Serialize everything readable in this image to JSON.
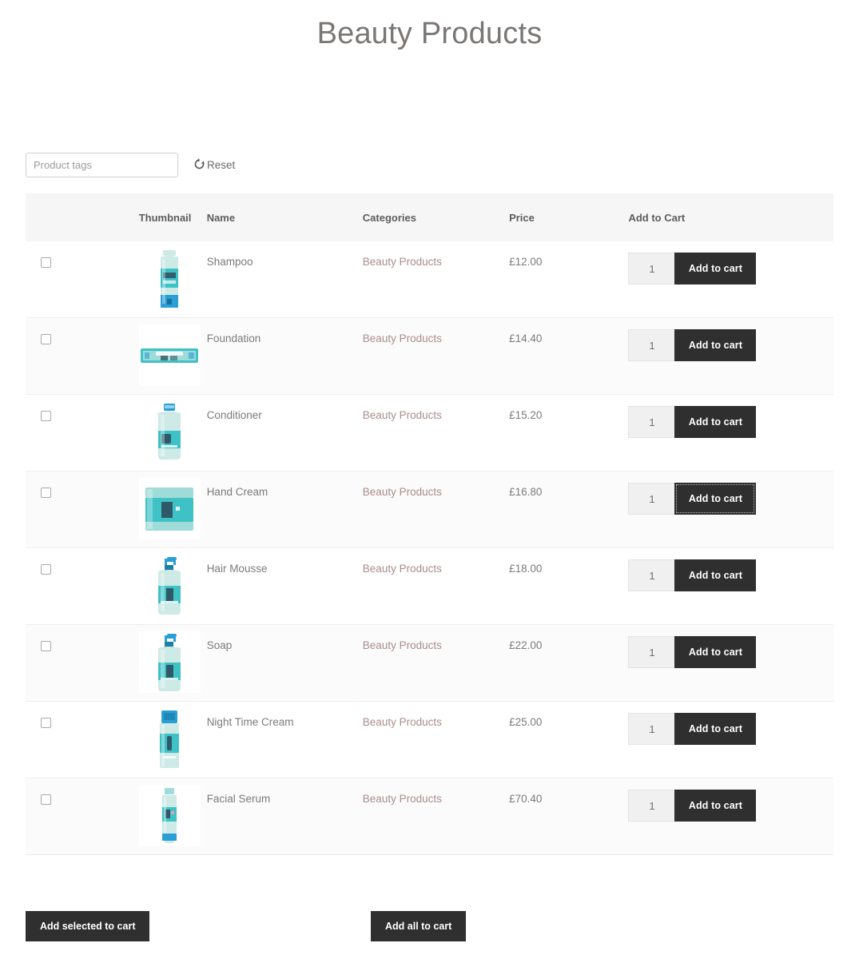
{
  "page": {
    "title": "Beauty Products"
  },
  "filter": {
    "tags_placeholder": "Product tags",
    "tags_value": "",
    "reset_label": "Reset",
    "reset_icon": "refresh-circle-icon"
  },
  "table": {
    "headers": {
      "select": "",
      "thumbnail": "Thumbnail",
      "name": "Name",
      "categories": "Categories",
      "price": "Price",
      "add_to_cart": "Add to Cart"
    },
    "rows": [
      {
        "name": "Shampoo",
        "category": "Beauty Products",
        "price": "£12.00",
        "qty": "1",
        "add_label": "Add to cart",
        "selected": false,
        "focused": false,
        "thumb": "shampoo-bottle"
      },
      {
        "name": "Foundation",
        "category": "Beauty Products",
        "price": "£14.40",
        "qty": "1",
        "add_label": "Add to cart",
        "selected": false,
        "focused": false,
        "thumb": "foundation-palette"
      },
      {
        "name": "Conditioner",
        "category": "Beauty Products",
        "price": "£15.20",
        "qty": "1",
        "add_label": "Add to cart",
        "selected": false,
        "focused": false,
        "thumb": "conditioner-bottle"
      },
      {
        "name": "Hand Cream",
        "category": "Beauty Products",
        "price": "£16.80",
        "qty": "1",
        "add_label": "Add to cart",
        "selected": false,
        "focused": true,
        "thumb": "cream-jar"
      },
      {
        "name": "Hair Mousse",
        "category": "Beauty Products",
        "price": "£18.00",
        "qty": "1",
        "add_label": "Add to cart",
        "selected": false,
        "focused": false,
        "thumb": "pump-bottle"
      },
      {
        "name": "Soap",
        "category": "Beauty Products",
        "price": "£22.00",
        "qty": "1",
        "add_label": "Add to cart",
        "selected": false,
        "focused": false,
        "thumb": "pump-bottle"
      },
      {
        "name": "Night Time Cream",
        "category": "Beauty Products",
        "price": "£25.00",
        "qty": "1",
        "add_label": "Add to cart",
        "selected": false,
        "focused": false,
        "thumb": "spray-can"
      },
      {
        "name": "Facial Serum",
        "category": "Beauty Products",
        "price": "£70.40",
        "qty": "1",
        "add_label": "Add to cart",
        "selected": false,
        "focused": false,
        "thumb": "serum-tube"
      }
    ]
  },
  "footer": {
    "add_selected_label": "Add selected to cart",
    "add_all_label": "Add all to cart"
  },
  "colors": {
    "button_dark": "#2f2f2f",
    "category_link": "#a98d8d",
    "header_bg": "#f6f6f6",
    "product_teal": "#2bb3b8",
    "title_text": "#7a7775"
  }
}
